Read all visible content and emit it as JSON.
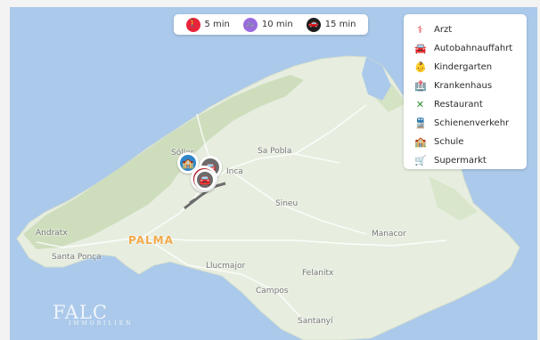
{
  "travel_times": [
    {
      "label": "5 min",
      "icon": "walking-icon",
      "color": "#e8243a",
      "glyph": "🚶"
    },
    {
      "label": "10 min",
      "icon": "bicycle-icon",
      "color": "#9a6adf",
      "glyph": "🚲"
    },
    {
      "label": "15 min",
      "icon": "car-icon",
      "color": "#1d1d1d",
      "glyph": "🚗"
    }
  ],
  "legend": [
    {
      "label": "Arzt",
      "icon": "stethoscope-icon",
      "color": "#d81f2a",
      "glyph": "⚕"
    },
    {
      "label": "Autobahnauffahrt",
      "icon": "car-on-road-icon",
      "color": "#555",
      "glyph": "🚘"
    },
    {
      "label": "Kindergarten",
      "icon": "child-icon",
      "color": "#2c6fc6",
      "glyph": "👶"
    },
    {
      "label": "Krankenhaus",
      "icon": "hospital-icon",
      "color": "#c00000",
      "glyph": "🏥"
    },
    {
      "label": "Restaurant",
      "icon": "cutlery-icon",
      "color": "#2e8b2e",
      "glyph": "✕"
    },
    {
      "label": "Schienenverkehr",
      "icon": "train-icon",
      "color": "#333",
      "glyph": "🚆"
    },
    {
      "label": "Schule",
      "icon": "school-icon",
      "color": "#2c78c6",
      "glyph": "🏫"
    },
    {
      "label": "Supermarkt",
      "icon": "shopping-cart-icon",
      "color": "#1b4fb0",
      "glyph": "🛒"
    }
  ],
  "places": {
    "soller": "Sóller",
    "inca": "Inca",
    "sa_pobla": "Sa Pobla",
    "sineu": "Sineu",
    "palma": "PALMA",
    "andratx": "Andratx",
    "santa_ponca": "Santa Ponça",
    "manacor": "Manacor",
    "llucmajor": "Llucmajor",
    "felanitx": "Felanitx",
    "campos": "Campos",
    "santanyi": "Santanyí"
  },
  "watermark": {
    "main": "FALC",
    "sub": "IMMOBILIEN"
  }
}
